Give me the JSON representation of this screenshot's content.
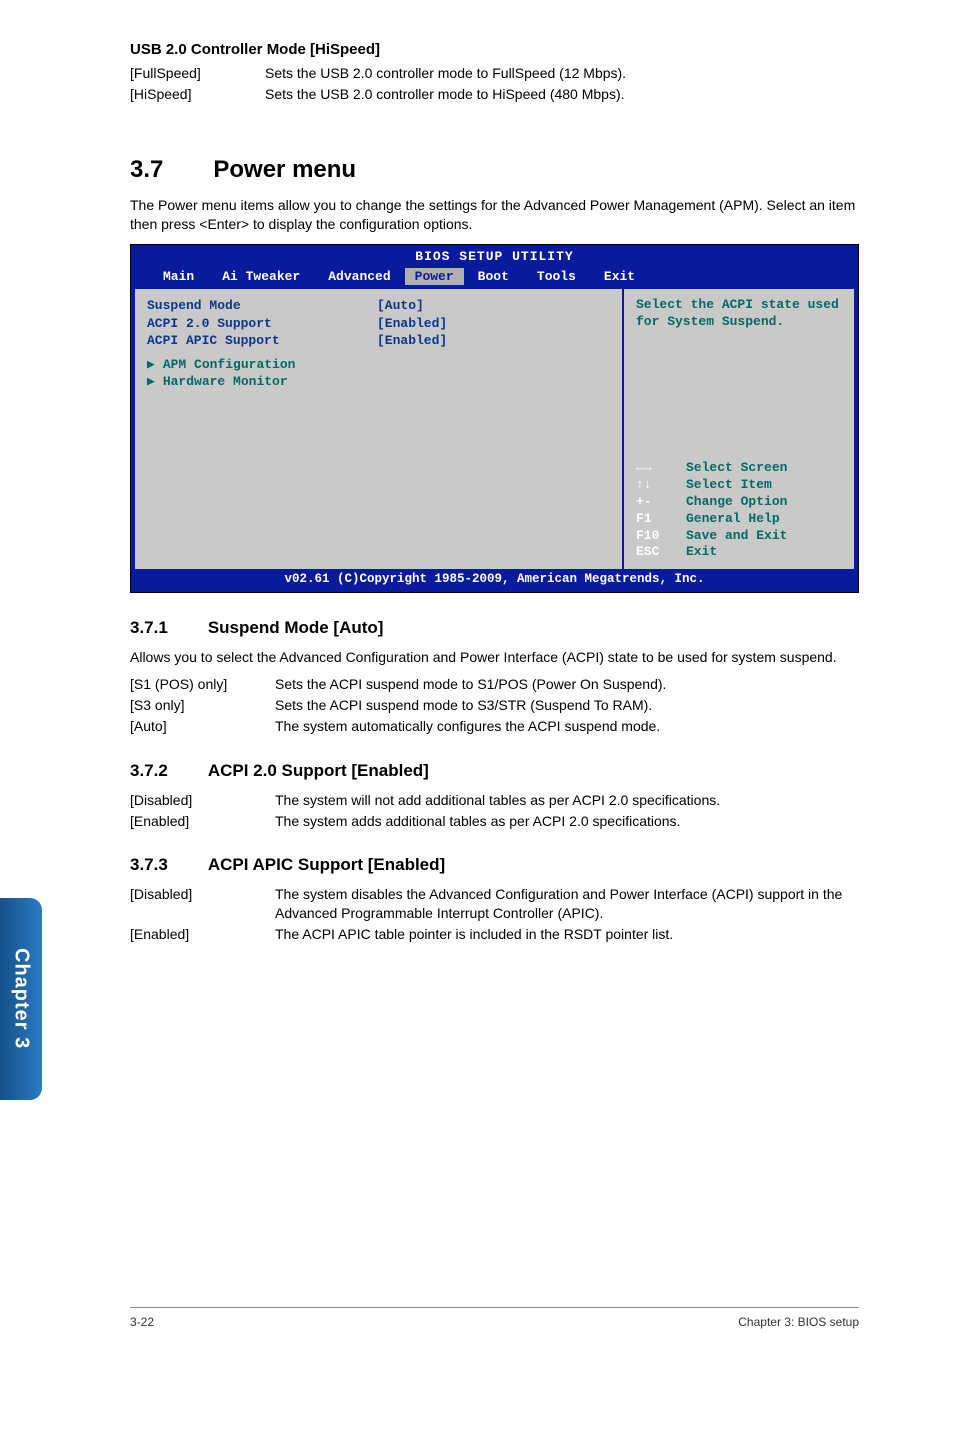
{
  "usb": {
    "heading": "USB 2.0 Controller Mode [HiSpeed]",
    "rows": [
      {
        "k": "[FullSpeed]",
        "v": "Sets the USB 2.0 controller mode to FullSpeed (12 Mbps)."
      },
      {
        "k": "[HiSpeed]",
        "v": "Sets the USB 2.0 controller mode to HiSpeed (480 Mbps)."
      }
    ]
  },
  "section": {
    "num": "3.7",
    "title": "Power menu",
    "intro": "The Power menu items allow you to change the settings for the Advanced Power Management (APM). Select an item then press <Enter> to display the configuration options."
  },
  "bios": {
    "title": "BIOS SETUP UTILITY",
    "menu": [
      "Main",
      "Ai Tweaker",
      "Advanced",
      "Power",
      "Boot",
      "Tools",
      "Exit"
    ],
    "selected": "Power",
    "left": {
      "rows": [
        {
          "label": "Suspend Mode",
          "value": "[Auto]"
        },
        {
          "label": "ACPI 2.0 Support",
          "value": "[Enabled]"
        },
        {
          "label": "ACPI APIC Support",
          "value": "[Enabled]"
        }
      ],
      "subs": [
        "APM Configuration",
        "Hardware Monitor"
      ]
    },
    "right": {
      "help": "Select the ACPI state used for System Suspend.",
      "keys": [
        {
          "k": "←→",
          "d": "Select Screen"
        },
        {
          "k": "↑↓",
          "d": "Select Item"
        },
        {
          "k": "+-",
          "d": "Change Option"
        },
        {
          "k": "F1",
          "d": "General Help"
        },
        {
          "k": "F10",
          "d": "Save and Exit"
        },
        {
          "k": "ESC",
          "d": "Exit"
        }
      ]
    },
    "footer": "v02.61 (C)Copyright 1985-2009, American Megatrends, Inc."
  },
  "s371": {
    "num": "3.7.1",
    "title": "Suspend Mode [Auto]",
    "intro": "Allows you to select the Advanced Configuration and Power Interface (ACPI) state to be used for system suspend.",
    "rows": [
      {
        "k": "[S1 (POS) only]",
        "v": "Sets the ACPI suspend mode to S1/POS (Power On Suspend)."
      },
      {
        "k": "[S3 only]",
        "v": "Sets the ACPI suspend mode to S3/STR (Suspend To RAM)."
      },
      {
        "k": "[Auto]",
        "v": "The system automatically configures the ACPI suspend mode."
      }
    ]
  },
  "s372": {
    "num": "3.7.2",
    "title": "ACPI 2.0 Support [Enabled]",
    "rows": [
      {
        "k": "[Disabled]",
        "v": "The system will not add additional tables as per ACPI 2.0 specifications."
      },
      {
        "k": "[Enabled]",
        "v": "The system adds additional tables as per ACPI 2.0 specifications."
      }
    ]
  },
  "s373": {
    "num": "3.7.3",
    "title": "ACPI APIC Support [Enabled]",
    "rows": [
      {
        "k": "[Disabled]",
        "v": "The system disables the Advanced Configuration and Power Interface (ACPI) support in the Advanced Programmable Interrupt Controller (APIC)."
      },
      {
        "k": "[Enabled]",
        "v": "The ACPI APIC table pointer is included in the RSDT pointer list."
      }
    ]
  },
  "sidetab": "Chapter 3",
  "footer": {
    "left": "3-22",
    "right": "Chapter 3: BIOS setup"
  }
}
